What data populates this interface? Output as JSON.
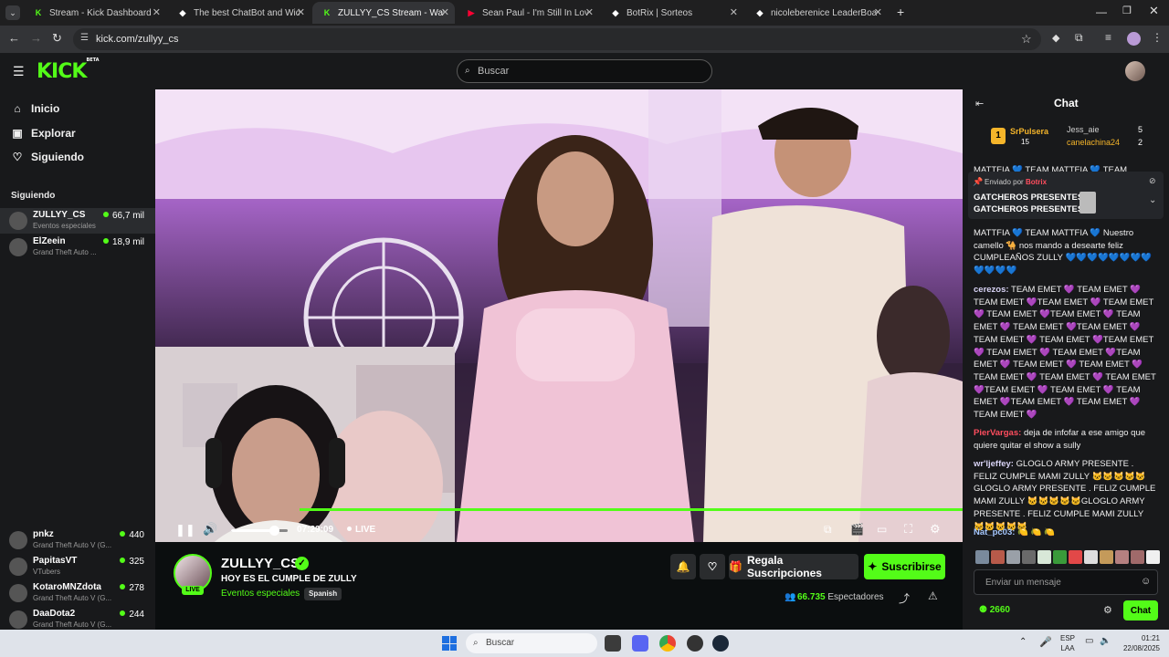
{
  "browser": {
    "tabs": [
      {
        "title": "Stream - Kick Dashboard",
        "fav": "K",
        "color": "#53fc18"
      },
      {
        "title": "The best ChatBot and Widgets",
        "fav": "◆",
        "color": "#ffffff"
      },
      {
        "title": "ZULLYY_CS Stream - Watch",
        "fav": "K",
        "color": "#53fc18"
      },
      {
        "title": "Sean Paul - I'm Still In Love With",
        "fav": "▶",
        "color": "#ff0033"
      },
      {
        "title": "BotRix | Sorteos",
        "fav": "◆",
        "color": "#ffffff"
      },
      {
        "title": "nicoleberenice LeaderBoard | T",
        "fav": "◆",
        "color": "#ffffff"
      }
    ],
    "new_tab": "+",
    "url": "kick.com/zullyy_cs"
  },
  "kick": {
    "logo": "KICK",
    "logo_badge": "BETA",
    "search_placeholder": "Buscar"
  },
  "sidebar": {
    "nav": [
      {
        "label": "Inicio",
        "icon": "⌂"
      },
      {
        "label": "Explorar",
        "icon": "▣"
      },
      {
        "label": "Siguiendo",
        "icon": "♡"
      }
    ],
    "following_title": "Siguiendo",
    "following": [
      {
        "name": "ZULLYY_CS",
        "game": "Eventos especiales",
        "viewers": "66,7 mil"
      },
      {
        "name": "ElZeein",
        "game": "Grand Theft Auto ...",
        "viewers": "18,9 mil"
      }
    ],
    "following_lower": [
      {
        "name": "pnkz",
        "game": "Grand Theft Auto V (G...",
        "viewers": "440"
      },
      {
        "name": "PapitasVT",
        "game": "VTubers",
        "viewers": "325"
      },
      {
        "name": "KotaroMNZdota",
        "game": "Grand Theft Auto V (G...",
        "viewers": "278"
      },
      {
        "name": "DaaDota2",
        "game": "Grand Theft Auto V (G...",
        "viewers": "244"
      }
    ]
  },
  "player": {
    "time": "07:29:09",
    "live": "LIVE",
    "volume": 0.75
  },
  "stream": {
    "channel": "ZULLYY_CS",
    "title": "HOY ES EL CUMPLE DE ZULLY",
    "category": "Eventos especiales",
    "language": "Spanish",
    "live_badge": "LIVE",
    "gift_label": "Regala Suscripciones",
    "subscribe_label": "Suscribirse",
    "viewers": "66.735",
    "viewers_label": "Espectadores"
  },
  "chat": {
    "title": "Chat",
    "leaderboard": [
      {
        "rank": "1",
        "name": "SrPulsera",
        "value": "15"
      },
      {
        "name": "Jess_aie",
        "value": "5"
      },
      {
        "name": "canelachina24",
        "value": "2"
      }
    ],
    "pinned": {
      "sent_by": "Enviado por",
      "sender": "Botrix",
      "line1": "GATCHEROS PRESENTES",
      "line2": "GATCHEROS PRESENTES",
      "ellipsis": "..."
    },
    "top_partial": "MATTFIA 💙 TEAM MATTFIA 💙 TEAM",
    "messages": [
      {
        "user": "",
        "color": "#ffffff",
        "text": "MATTFIA 💙 TEAM MATTFIA 💙 Nuestro camello 🐪 nos mando a desearte feliz CUMPLEAÑOS ZULLY 💙💙💙💙💙💙💙💙💙💙💙💙"
      },
      {
        "user": "cerezos:",
        "color": "#d8d3f5",
        "text": "TEAM EMET 💜 TEAM EMET 💜 TEAM EMET 💜TEAM EMET 💜 TEAM EMET 💜 TEAM EMET 💜TEAM EMET 💜 TEAM EMET 💜 TEAM EMET 💜TEAM EMET 💜 TEAM EMET 💜 TEAM EMET 💜TEAM EMET 💜 TEAM EMET 💜 TEAM EMET 💜TEAM EMET 💜 TEAM EMET 💜 TEAM EMET 💜TEAM EMET 💜 TEAM EMET 💜 TEAM EMET 💜TEAM EMET 💜 TEAM EMET 💜 TEAM EMET 💜TEAM EMET 💜 TEAM EMET 💜 TEAM EMET 💜"
      },
      {
        "user": "PierVargas:",
        "color": "#ff4d5e",
        "text": "deja de infofar a ese amigo que quiere quitar el show a sully"
      },
      {
        "user": "wr'ljeffey:",
        "color": "#d8d3f5",
        "text": "GLOGLO ARMY PRESENTE . FELIZ CUMPLE MAMI ZULLY 🐱🐱🐱🐱🐱GLOGLO ARMY PRESENTE . FELIZ CUMPLE MAMI ZULLY 🐱🐱🐱🐱🐱GLOGLO ARMY PRESENTE . FELIZ CUMPLE MAMI ZULLY 🐱🐱🐱🐱🐱"
      },
      {
        "user": "Nat_pc03:",
        "color": "#a6c8ff",
        "text": "🍋 🍋 🍋"
      }
    ],
    "input_placeholder": "Enviar un mensaje",
    "points": "2660",
    "send_label": "Chat"
  },
  "taskbar": {
    "search": "Buscar",
    "lang1": "ESP",
    "lang2": "LAA",
    "time": "01:21",
    "date": "22/08/2025"
  }
}
